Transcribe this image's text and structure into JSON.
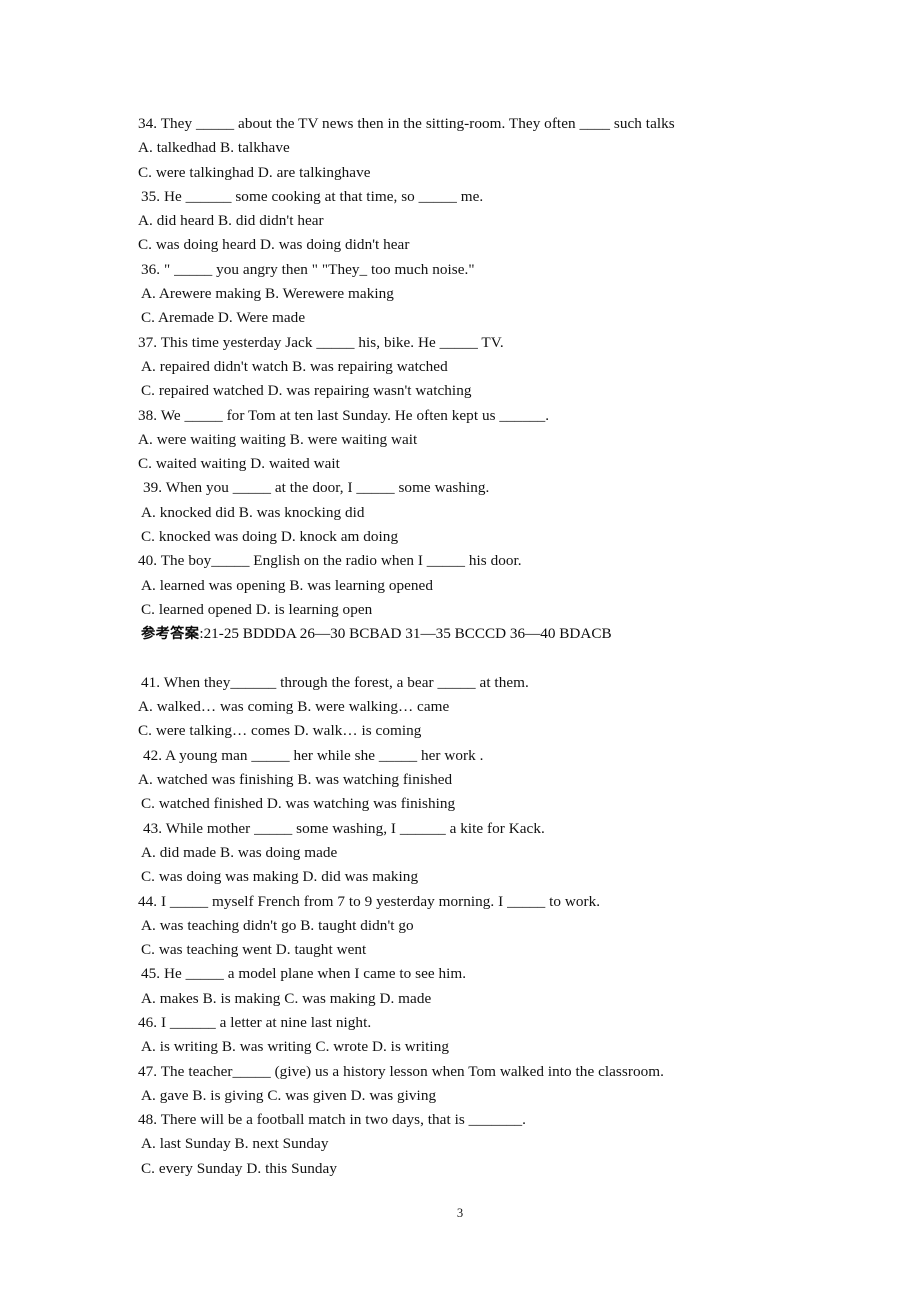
{
  "document": {
    "type": "scanned-worksheet",
    "page_number": "3",
    "subject_language": "English grammar multiple-choice exercise"
  },
  "section_one": {
    "lines": [
      "34. They _____ about the TV news then in the sitting-room. They often ____ such talks",
      "A. talkedhad B. talkhave",
      "C. were talkinghad D. are talkinghave",
      "35. He ______ some cooking at that time, so _____ me.",
      "A. did heard B. did didn't hear",
      "C. was doing heard D. was doing didn't hear",
      "36. \" _____ you angry then \" \"They_ too much noise.\"",
      "A. Arewere making B. Werewere making",
      "C. Aremade D. Were made",
      "37. This time yesterday Jack _____ his, bike. He _____ TV.",
      "A. repaired didn't watch B. was repairing watched",
      "C. repaired watched D. was repairing wasn't watching",
      "38. We _____ for Tom at ten last Sunday. He often kept us ______.",
      "A. were waiting waiting B. were waiting wait",
      "C. waited waiting D. waited wait",
      "39. When you _____ at the door, I _____ some washing.",
      "A. knocked did B. was knocking did",
      "C. knocked was doing D. knock am doing",
      "40. The boy_____ English on the radio when I _____ his door.",
      "A. learned was opening B. was learning opened",
      "C. learned opened D. is learning open"
    ]
  },
  "answer_key": {
    "label": "参考答案",
    "body": ":21-25 BDDDA 26—30 BCBAD 31—35 BCCCD 36—40 BDACB"
  },
  "section_two": {
    "lines": [
      "41. When they______ through the forest, a bear _____ at them.",
      "A. walked… was coming B. were walking… came",
      "C. were talking… comes D. walk… is coming",
      "42. A young man _____ her while she _____ her work .",
      "A. watched was finishing B. was watching finished",
      "C. watched finished D. was watching was finishing",
      "43. While mother _____ some washing, I ______ a kite for Kack.",
      "A. did made B. was doing made",
      "C. was doing was making D. did was making",
      "44. I _____ myself French from 7 to 9 yesterday morning. I _____ to work.",
      "A. was teaching didn't go B. taught didn't go",
      "C. was teaching went D. taught went",
      "45. He _____ a model plane when I came to see him.",
      "A. makes B. is making C. was making D. made",
      "46. I ______ a letter at nine last night.",
      "A. is writing B. was writing C. wrote D. is writing",
      "47. The teacher_____ (give) us a history lesson when Tom walked into the classroom.",
      "A. gave B. is giving C. was given D. was giving",
      "48. There will be a football match in two days, that is _______.",
      "A. last Sunday B. next Sunday",
      "C. every Sunday D. this Sunday"
    ]
  }
}
